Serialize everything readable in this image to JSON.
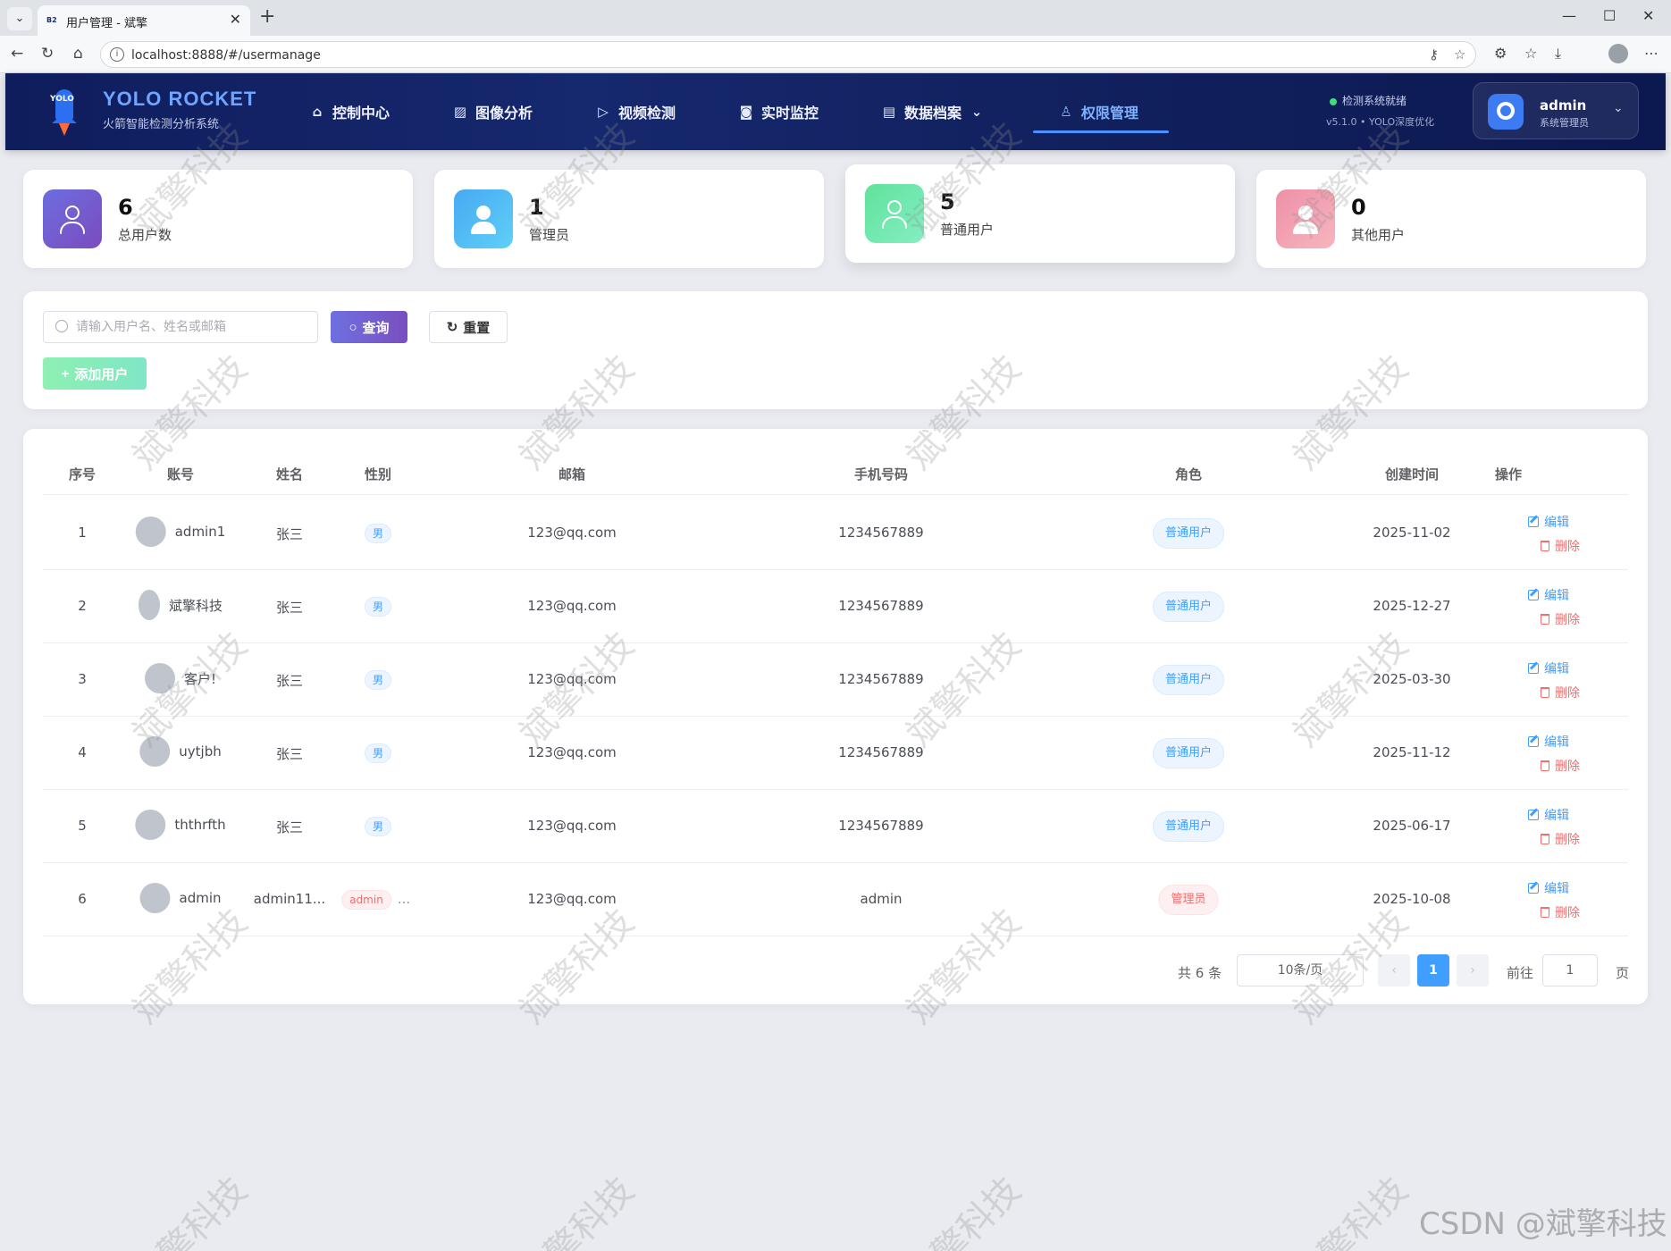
{
  "browser": {
    "tab_title": "用户管理 - 斌擎",
    "tab_favicon": "B2",
    "url": "localhost:8888/#/usermanage"
  },
  "header": {
    "logo_text": "YOLO",
    "brand_title": "YOLO ROCKET",
    "brand_sub": "火箭智能检测分析系统",
    "nav": [
      {
        "label": "控制中心",
        "icon": "home-icon"
      },
      {
        "label": "图像分析",
        "icon": "image-icon"
      },
      {
        "label": "视频检测",
        "icon": "play-circle-icon"
      },
      {
        "label": "实时监控",
        "icon": "camera-icon"
      },
      {
        "label": "数据档案",
        "icon": "document-icon"
      },
      {
        "label": "权限管理",
        "icon": "user-icon"
      }
    ],
    "active_nav": "权限管理",
    "system_status": "检测系统就绪",
    "version": "v5.1.0 • YOLO深度优化",
    "user_name": "admin",
    "user_role": "系统管理员",
    "accent_color": "#4d90ff"
  },
  "stats": [
    {
      "value": "6",
      "label": "总用户数",
      "color": "#7b5fd0"
    },
    {
      "value": "1",
      "label": "管理员",
      "color": "#4fb5f5"
    },
    {
      "value": "5",
      "label": "普通用户",
      "color": "#6ee6a4"
    },
    {
      "value": "0",
      "label": "其他用户",
      "color": "#f19db0"
    }
  ],
  "search": {
    "placeholder": "请输入用户名、姓名或邮箱",
    "query_label": "查询",
    "reset_label": "重置",
    "add_label": "添加用户"
  },
  "table": {
    "columns": [
      "序号",
      "账号",
      "姓名",
      "性别",
      "邮箱",
      "手机号码",
      "角色",
      "创建时间",
      "操作"
    ],
    "rows": [
      {
        "index": "1",
        "account": "admin1",
        "name": "张三",
        "gender": "男",
        "email": "123@qq.com",
        "phone": "1234567889",
        "role": "普通用户",
        "created": "2025-11-02"
      },
      {
        "index": "2",
        "account": "斌擎科技",
        "name": "张三",
        "gender": "男",
        "email": "123@qq.com",
        "phone": "1234567889",
        "role": "普通用户",
        "created": "2025-12-27"
      },
      {
        "index": "3",
        "account": "客户!",
        "name": "张三",
        "gender": "男",
        "email": "123@qq.com",
        "phone": "1234567889",
        "role": "普通用户",
        "created": "2025-03-30"
      },
      {
        "index": "4",
        "account": "uytjbh",
        "name": "张三",
        "gender": "男",
        "email": "123@qq.com",
        "phone": "1234567889",
        "role": "普通用户",
        "created": "2025-11-12"
      },
      {
        "index": "5",
        "account": "ththrfth",
        "name": "张三",
        "gender": "男",
        "email": "123@qq.com",
        "phone": "1234567889",
        "role": "普通用户",
        "created": "2025-06-17"
      },
      {
        "index": "6",
        "account": "admin",
        "name": "admin11...",
        "gender": "admin",
        "gender_suffix": "...",
        "email": "123@qq.com",
        "phone": "admin",
        "role": "管理员",
        "created": "2025-10-08"
      }
    ],
    "edit_label": "编辑",
    "delete_label": "删除"
  },
  "pagination": {
    "total": "共 6 条",
    "page_size": "10条/页",
    "current_page": "1",
    "goto_label": "前往",
    "goto_value": "1",
    "page_unit": "页"
  },
  "watermark": {
    "text": "斌擎科技",
    "csdn": "CSDN @斌擎科技"
  }
}
